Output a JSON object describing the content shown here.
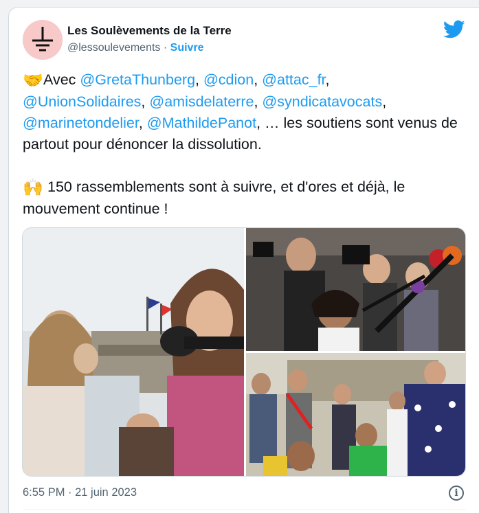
{
  "author": {
    "name": "Les Soulèvements de la Terre",
    "handle": "@lessoulevements",
    "separator": "·",
    "follow_label": "Suivre"
  },
  "tweet": {
    "paragraph1": {
      "emoji": "🤝",
      "lead": "Avec ",
      "mentions": [
        "@GretaThunberg",
        "@cdion",
        "@attac_fr",
        "@UnionSolidaires",
        "@amisdelaterre",
        "@syndicatavocats",
        "@marinetondelier",
        "@MathildePanot"
      ],
      "tail": ", … les soutiens sont venus de partout pour dénoncer la dissolution."
    },
    "paragraph2": {
      "emoji": "🙌",
      "text": "150 rassemblements sont à suivre, et d'ores et déjà, le mouvement continue !"
    },
    "separator": ", "
  },
  "footer": {
    "timestamp": "6:55 PM · 21 juin 2023",
    "info_symbol": "i"
  },
  "colors": {
    "link": "#1d9bf0",
    "text": "#0f1419",
    "muted": "#536471",
    "twitter_blue": "#1d9bf0"
  },
  "icons": {
    "logo": "twitter-bird-icon",
    "info": "info-icon",
    "avatar": "earth-ground-symbol"
  }
}
